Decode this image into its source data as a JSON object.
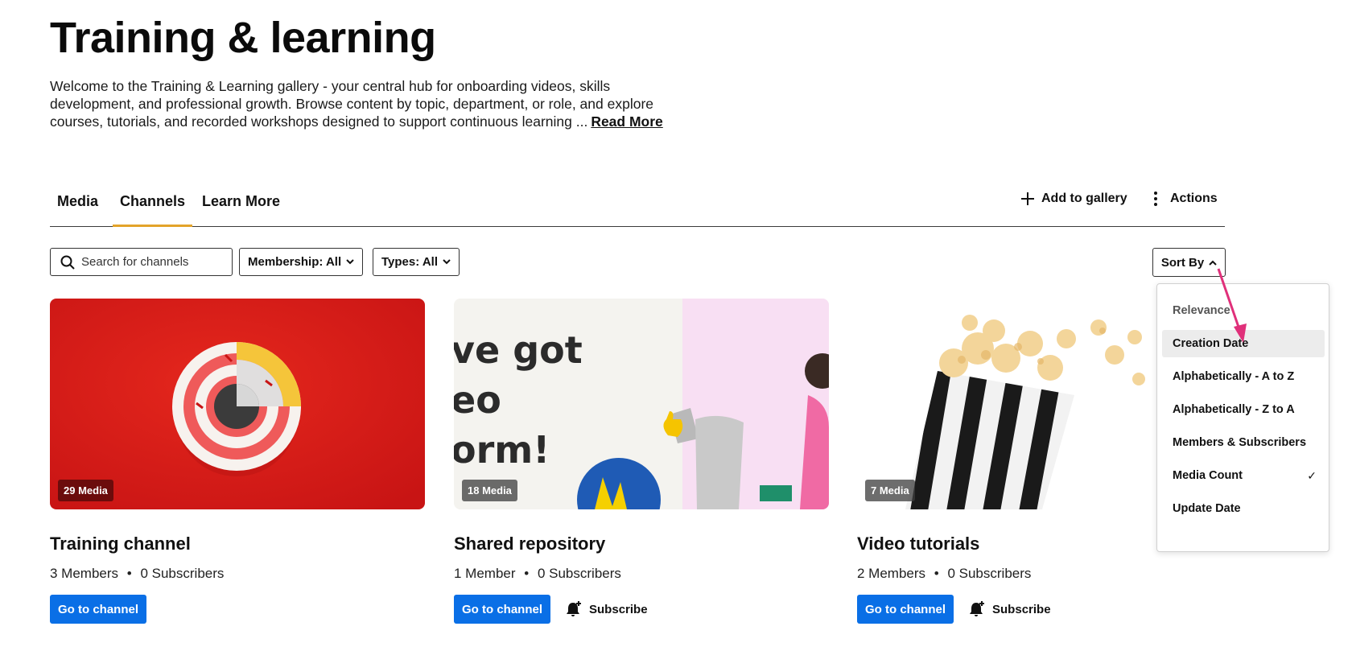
{
  "page": {
    "title": "Training & learning",
    "intro": "Welcome to the Training & Learning gallery - your central hub for onboarding videos, skills development, and professional growth. Browse content by topic, department, or role, and explore courses, tutorials, and recorded workshops designed to support continuous learning ...",
    "read_more": "Read More"
  },
  "tabs": [
    {
      "label": "Media",
      "active": false
    },
    {
      "label": "Channels",
      "active": true
    },
    {
      "label": "Learn More",
      "active": false
    }
  ],
  "toolbar": {
    "add_label": "Add to gallery",
    "actions_label": "Actions"
  },
  "filters": {
    "search_placeholder": "Search for channels",
    "membership": "Membership: All",
    "types": "Types: All",
    "sort_label": "Sort By"
  },
  "sort_menu": {
    "items": [
      {
        "label": "Relevance",
        "state": "muted"
      },
      {
        "label": "Creation Date",
        "state": "hover"
      },
      {
        "label": "Alphabetically - A to Z"
      },
      {
        "label": "Alphabetically - Z to A"
      },
      {
        "label": "Members & Subscribers"
      },
      {
        "label": "Media Count",
        "checked": true
      },
      {
        "label": "Update Date"
      }
    ],
    "check_glyph": "✓"
  },
  "cards": [
    {
      "badge": "29 Media",
      "title": "Training channel",
      "members": "3 Members",
      "subscribers": "0 Subscribers",
      "go_label": "Go to channel"
    },
    {
      "badge": "18 Media",
      "title": "Shared repository",
      "members": "1 Member",
      "subscribers": "0 Subscribers",
      "go_label": "Go to channel",
      "subscribe_label": "Subscribe",
      "thumb_text": [
        "ve got",
        "eo",
        "orm!"
      ]
    },
    {
      "badge": "7 Media",
      "title": "Video tutorials",
      "members": "2 Members",
      "subscribers": "0 Subscribers",
      "go_label": "Go to channel",
      "subscribe_label": "Subscribe"
    }
  ],
  "separator": "•",
  "colors": {
    "accent_tab": "#e3a32a",
    "primary_button": "#0a6fe6",
    "annotation_arrow": "#e0307a"
  }
}
